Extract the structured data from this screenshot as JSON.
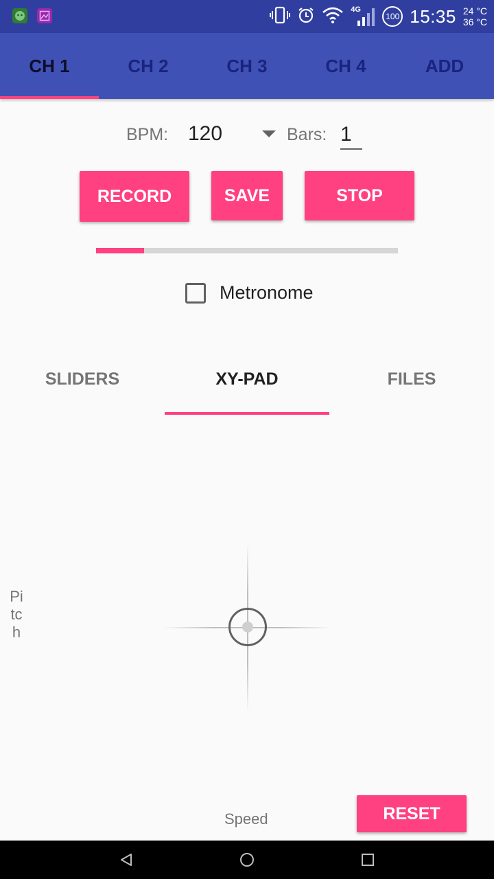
{
  "status_bar": {
    "time": "15:35",
    "temp_top": "24 °C",
    "temp_bottom": "36 °C",
    "battery": "100",
    "network": "4G",
    "icons": [
      "android-debug-icon",
      "gallery-icon",
      "vibrate-icon",
      "alarm-icon",
      "wifi-icon",
      "signal-icon",
      "battery-icon"
    ]
  },
  "channel_tabs": {
    "items": [
      {
        "label": "CH 1",
        "active": true
      },
      {
        "label": "CH 2",
        "active": false
      },
      {
        "label": "CH 3",
        "active": false
      },
      {
        "label": "CH 4",
        "active": false
      },
      {
        "label": "ADD",
        "active": false
      }
    ]
  },
  "bpm": {
    "label": "BPM:",
    "value": "120"
  },
  "bars": {
    "label": "Bars:",
    "value": "1"
  },
  "controls": {
    "record_label": "RECORD",
    "save_label": "SAVE",
    "stop_label": "STOP"
  },
  "progress": {
    "fraction": 0.16
  },
  "metronome": {
    "label": "Metronome",
    "checked": false
  },
  "mode_tabs": {
    "items": [
      {
        "label": "SLIDERS",
        "active": false
      },
      {
        "label": "XY-PAD",
        "active": true
      },
      {
        "label": "FILES",
        "active": false
      }
    ]
  },
  "xy_pad": {
    "y_label": "Pitch",
    "x_label": "Speed",
    "reset_label": "RESET"
  },
  "colors": {
    "primary": "#3f51b5",
    "primary_dark": "#303f9f",
    "accent": "#ff4081"
  }
}
